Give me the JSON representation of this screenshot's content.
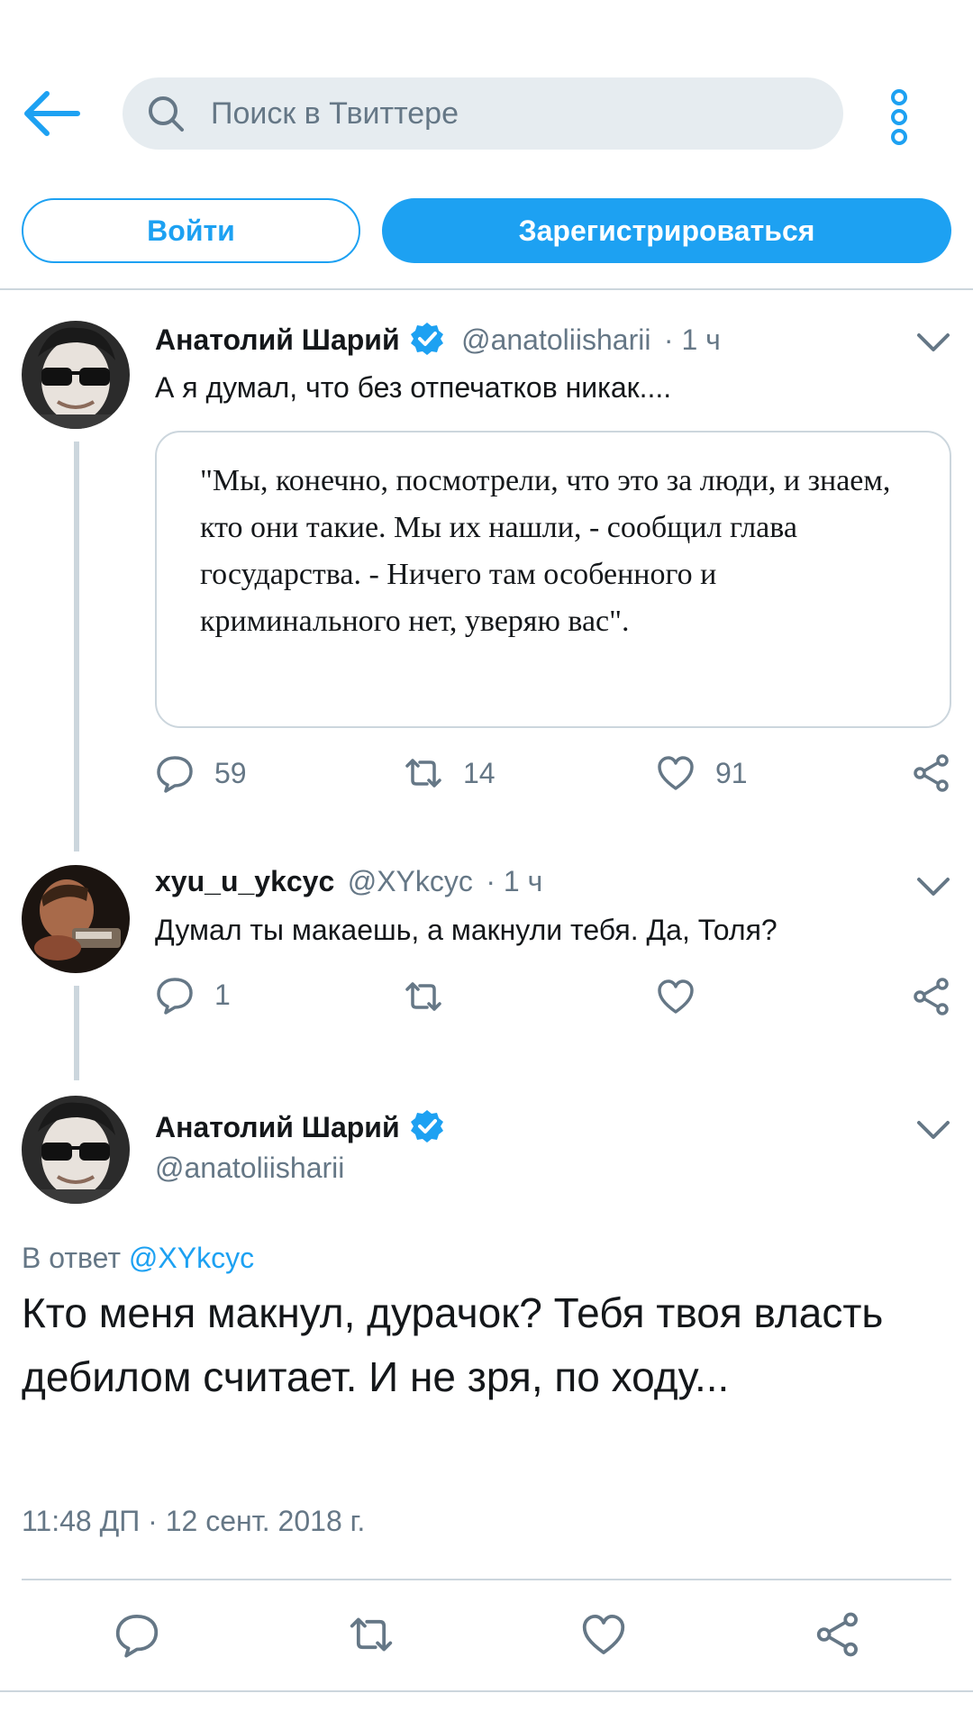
{
  "header": {
    "search_placeholder": "Поиск в Твиттере",
    "login_label": "Войти",
    "signup_label": "Зарегистрироваться"
  },
  "tweets": [
    {
      "name": "Анатолий Шарий",
      "handle": "@anatoliisharii",
      "time": "· 1 ч",
      "text": "А я думал, что без отпечатков никак....",
      "quote": "\"Мы, конечно, посмотрели, что это за люди, и знаем, кто они такие. Мы их нашли, - сообщил глава государства. - Ничего там особенного и криминального нет, уверяю вас\".",
      "replies": "59",
      "retweets": "14",
      "likes": "91"
    },
    {
      "name": "xyu_u_ykcyc",
      "handle": "@XYkcyc",
      "time": "· 1 ч",
      "text": "Думал ты макаешь, а макнули тебя. Да, Толя?",
      "replies": "1"
    }
  ],
  "main_tweet": {
    "name": "Анатолий Шарий",
    "handle": "@anatoliisharii",
    "reply_prefix": "В ответ",
    "reply_handle": "@XYkcyc",
    "text": "Кто меня макнул, дурачок? Тебя твоя власть дебилом считает. И не зря, по ходу...",
    "timestamp": "11:48 ДП · 12 сент. 2018 г."
  },
  "colors": {
    "accent": "#1da1f2",
    "muted": "#657786",
    "border": "#ccd6dd",
    "search_bg": "#e6ecf0"
  },
  "icons": [
    "back-arrow-icon",
    "search-icon",
    "more-vertical-icon",
    "verified-icon",
    "chevron-down-icon",
    "reply-icon",
    "retweet-icon",
    "like-icon",
    "share-icon"
  ]
}
